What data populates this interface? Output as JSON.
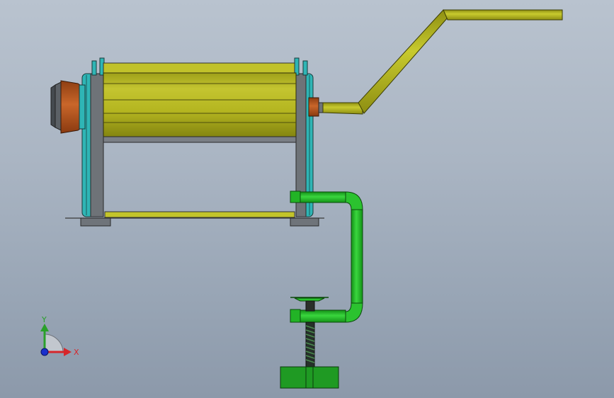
{
  "triad": {
    "x_label": "X",
    "y_label": "Y",
    "colors": {
      "x": "#d7262a",
      "y": "#2aa02a",
      "z": "#1a2fcc"
    }
  },
  "colors": {
    "drum": "#b4b520",
    "drum_dark": "#8a8a12",
    "frame_teal": "#2fb5b5",
    "frame_gray": "#6e7378",
    "cap_orange": "#b8561b",
    "handle": "#b2b41c",
    "clamp_green": "#26c02a",
    "clamp_dark": "#148a1a"
  }
}
